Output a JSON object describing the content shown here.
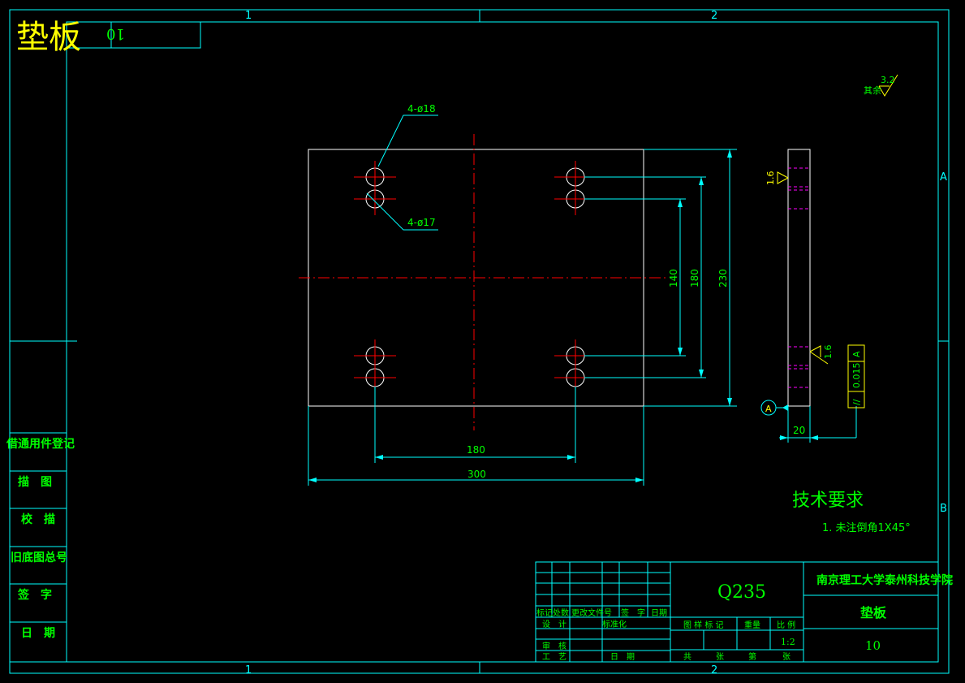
{
  "colors": {
    "frame": "#00ffff",
    "text": "#00ff00",
    "outline": "#ffffff",
    "center": "#ff0000",
    "title": "#ffff00",
    "hidden": "#ff00ff"
  },
  "header": {
    "title": "垫板",
    "code": "10"
  },
  "zones": {
    "col1": "1",
    "col2": "2",
    "rowA": "A",
    "rowB": "B"
  },
  "roughness": {
    "rest_label": "其余",
    "rest_value": "3.2",
    "face_value": "1.6"
  },
  "callouts": {
    "hole_top": "4-ø18",
    "hole_bottom": "4-ø17"
  },
  "dimensions": {
    "d140": "140",
    "d180v": "180",
    "d230": "230",
    "d180h": "180",
    "d300": "300",
    "d20": "20"
  },
  "tolerance": {
    "symbol": "//",
    "value": "0.015",
    "datum": "A"
  },
  "datum_label": "A",
  "tech": {
    "title": "技术要求",
    "item1": "1. 未注倒角1X45°"
  },
  "side_table": {
    "rows": [
      "借通用件登记",
      "描　图",
      "校　描",
      "旧底图总号",
      "签　字",
      "日　期"
    ]
  },
  "title_block": {
    "material": "Q235",
    "school": "南京理工大学泰州科技学院",
    "part_name": "垫板",
    "drawing_no": "10",
    "row_labels": [
      "标记",
      "处数",
      "更改文件号",
      "签　字",
      "日期"
    ],
    "design": "设　计",
    "standardize_date": "标准化",
    "review": "审　核",
    "craft": "工　艺",
    "date": "日　期",
    "stage": "图 样 标 记",
    "weight": "重量",
    "scale_label": "比 例",
    "scale": "1:2",
    "total": "共",
    "sheet": "张",
    "page": "第",
    "sheet2": "张"
  }
}
